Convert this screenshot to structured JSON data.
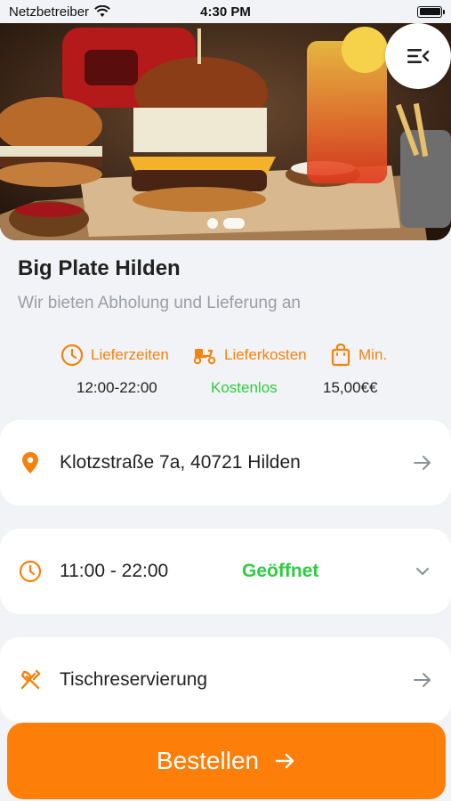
{
  "status_bar": {
    "carrier": "Netzbetreiber",
    "time": "4:30 PM"
  },
  "hero": {
    "menu_icon": "menu-collapse-icon",
    "carousel_count": 2,
    "carousel_active": 2
  },
  "restaurant": {
    "name": "Big Plate Hilden",
    "tagline": "Wir bieten Abholung und Lieferung an"
  },
  "info": {
    "delivery_times_label": "Lieferzeiten",
    "delivery_cost_label": "Lieferkosten",
    "minimum_label": "Min.",
    "delivery_times_value": "12:00-22:00",
    "delivery_cost_value": "Kostenlos",
    "minimum_value": "15,00€€"
  },
  "address_card": {
    "text": "Klotzstraße 7a, 40721 Hilden"
  },
  "hours_card": {
    "hours": "11:00 - 22:00",
    "status": "Geöffnet"
  },
  "reservation_card": {
    "label": "Tischreservierung"
  },
  "order_button": {
    "label": "Bestellen"
  },
  "colors": {
    "accent": "#fd7e09",
    "open_green": "#2ecc40",
    "background": "#f2f3f6"
  }
}
